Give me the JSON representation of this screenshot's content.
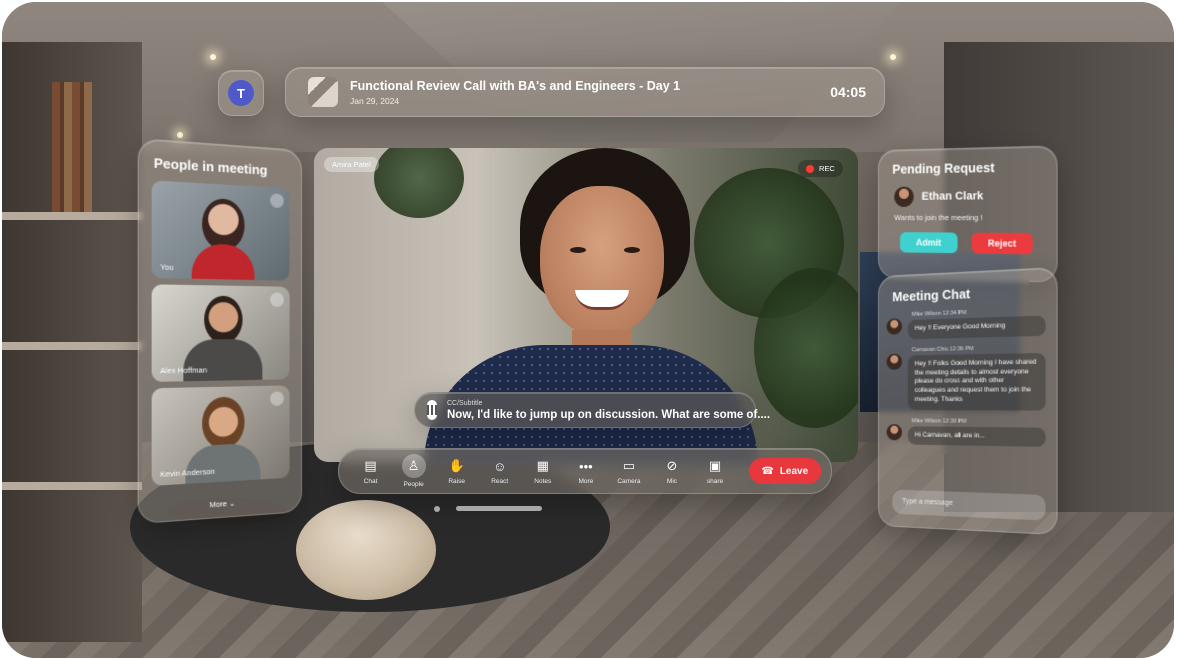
{
  "header": {
    "title": "Functional Review Call with BA's and Engineers - Day 1",
    "date": "Jan 29, 2024",
    "timer": "04:05"
  },
  "people_panel": {
    "title": "People in meeting",
    "participants": [
      {
        "name": "You"
      },
      {
        "name": "Alex Hoffman"
      },
      {
        "name": "Kevin Anderson"
      }
    ],
    "more_label": "More"
  },
  "video": {
    "speaker_name": "Amira Patel",
    "rec_label": "REC"
  },
  "subtitle": {
    "label": "CC/Subtitle",
    "text": "Now, I'd like to jump up on discussion. What are some of...."
  },
  "toolbar": {
    "items": [
      {
        "label": "Chat",
        "icon": "chat-icon"
      },
      {
        "label": "People",
        "icon": "people-icon"
      },
      {
        "label": "Raise",
        "icon": "hand-icon"
      },
      {
        "label": "React",
        "icon": "emoji-icon"
      },
      {
        "label": "Notes",
        "icon": "notes-icon"
      },
      {
        "label": "More",
        "icon": "more-icon"
      },
      {
        "label": "Camera",
        "icon": "camera-icon"
      },
      {
        "label": "Mic",
        "icon": "mic-off-icon"
      },
      {
        "label": "share",
        "icon": "share-icon"
      }
    ],
    "leave_label": "Leave"
  },
  "pending": {
    "title": "Pending Request",
    "name": "Ethan Clark",
    "message": "Wants to join the meeting !",
    "admit_label": "Admit",
    "reject_label": "Reject"
  },
  "chat": {
    "title": "Meeting Chat",
    "messages": [
      {
        "author": "Mike Wilson",
        "time": "12:34 PM",
        "text": "Hey !! Everyone Good Morning"
      },
      {
        "author": "Carnavan Chiu",
        "time": "12:36 PM",
        "text": "Hey !! Folks Good Morning I have shared the meeting details to almost everyone please do cross and with other colleagues and request them to join the meeting. Thanks"
      },
      {
        "author": "Mike Wilson",
        "time": "12:39 PM",
        "text": "Hi Carnavan, all are in..."
      }
    ],
    "input_placeholder": "Type a message"
  },
  "colors": {
    "leave": "#e8373d",
    "admit": "#3fd1cf",
    "reject": "#ec3b3f",
    "rec_dot": "#ff3a30",
    "teams": "#5059c9"
  }
}
